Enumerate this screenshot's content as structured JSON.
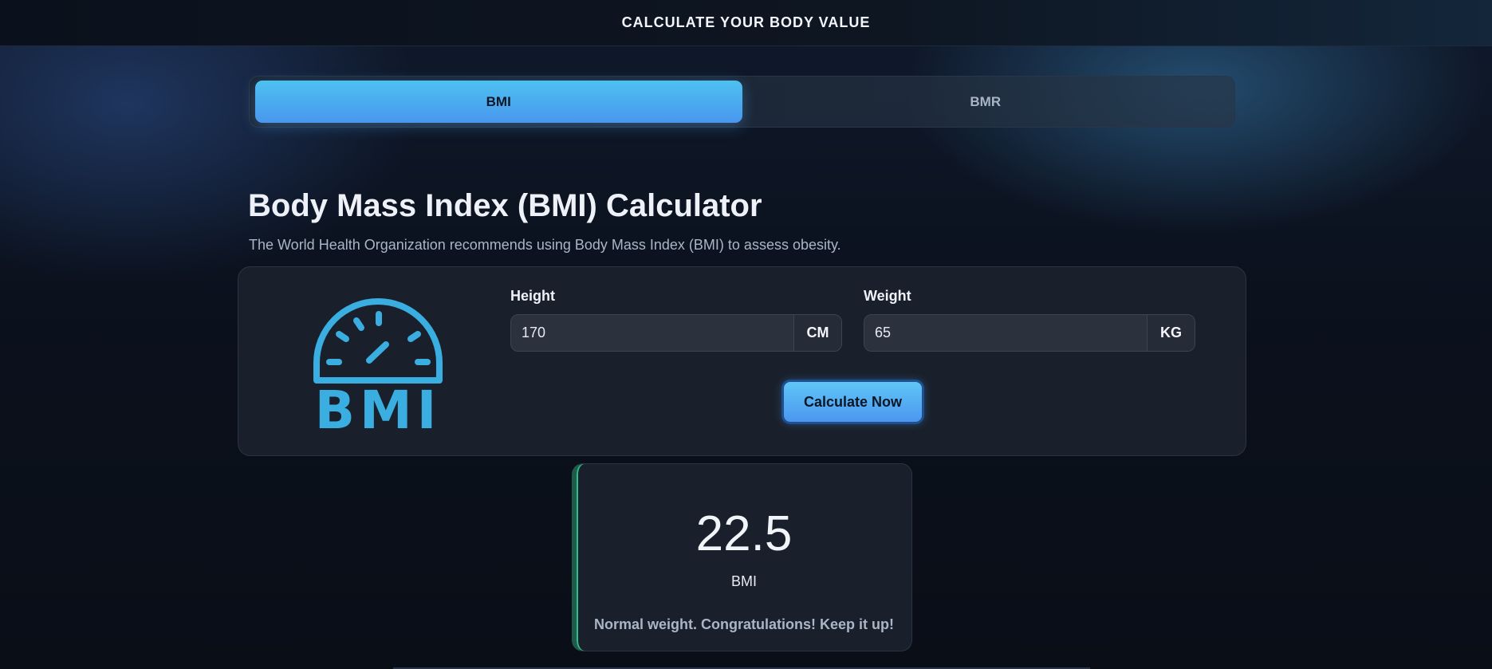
{
  "header": {
    "title": "CALCULATE YOUR BODY VALUE"
  },
  "tabs": [
    {
      "label": "BMI",
      "active": true
    },
    {
      "label": "BMR",
      "active": false
    }
  ],
  "main": {
    "title": "Body Mass Index (BMI) Calculator",
    "subtitle": "The World Health Organization recommends using Body Mass Index (BMI) to assess obesity."
  },
  "form": {
    "logo_icon": "bmi-gauge-icon",
    "logo_text": "BMI",
    "height": {
      "label": "Height",
      "value": "170",
      "unit": "CM"
    },
    "weight": {
      "label": "Weight",
      "value": "65",
      "unit": "KG"
    },
    "submit_label": "Calculate Now"
  },
  "result": {
    "value": "22.5",
    "unit": "BMI",
    "message": "Normal weight. Congratulations! Keep it up!",
    "accent_color": "#2fbf8a"
  },
  "colors": {
    "accent": "#4a97ee",
    "logo": "#3aaee0"
  }
}
